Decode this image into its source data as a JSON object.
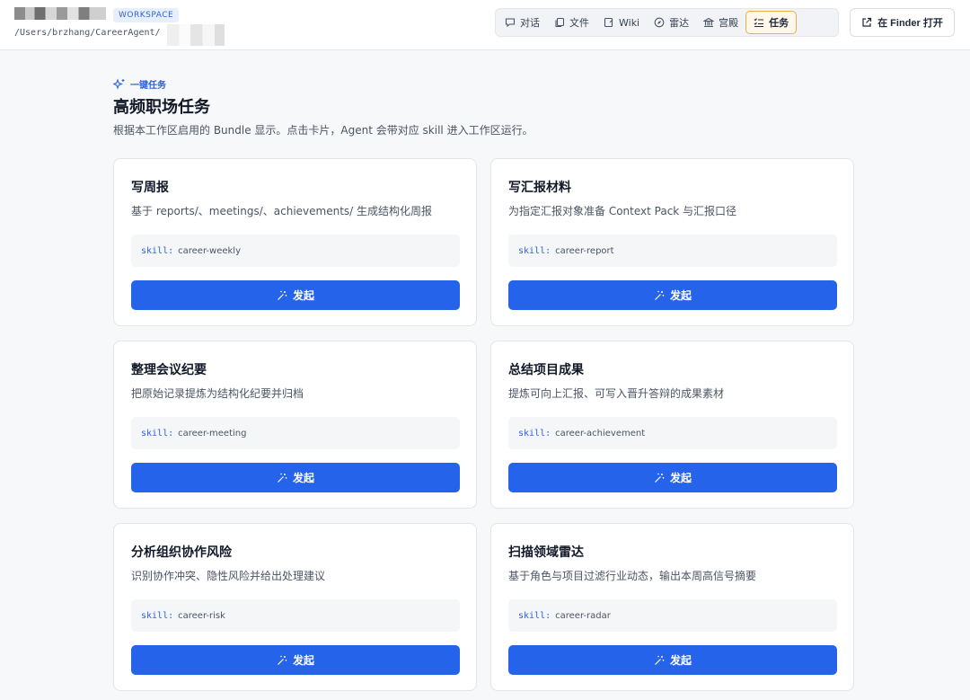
{
  "header": {
    "workspace_badge": "WORKSPACE",
    "workspace_path": "/Users/brzhang/CareerAgent/",
    "nav_tabs": [
      {
        "label": "对话",
        "icon": "chat-icon",
        "active": false
      },
      {
        "label": "文件",
        "icon": "files-icon",
        "active": false
      },
      {
        "label": "Wiki",
        "icon": "wiki-icon",
        "active": false
      },
      {
        "label": "雷达",
        "icon": "compass-icon",
        "active": false
      },
      {
        "label": "宫殿",
        "icon": "palace-icon",
        "active": false
      },
      {
        "label": "任务",
        "icon": "task-list-icon",
        "active": true
      }
    ],
    "open_finder_label": "在 Finder 打开"
  },
  "main": {
    "kicker": "一键任务",
    "title": "高频职场任务",
    "description": "根据本工作区启用的 Bundle 显示。点击卡片，Agent 会带对应 skill 进入工作区运行。",
    "skill_prefix": "skill:",
    "launch_label": "发起",
    "cards": [
      {
        "title": "写周报",
        "description": "基于 reports/、meetings/、achievements/ 生成结构化周报",
        "skill": "career-weekly"
      },
      {
        "title": "写汇报材料",
        "description": "为指定汇报对象准备 Context Pack 与汇报口径",
        "skill": "career-report"
      },
      {
        "title": "整理会议纪要",
        "description": "把原始记录提炼为结构化纪要并归档",
        "skill": "career-meeting"
      },
      {
        "title": "总结项目成果",
        "description": "提炼可向上汇报、可写入晋升答辩的成果素材",
        "skill": "career-achievement"
      },
      {
        "title": "分析组织协作风险",
        "description": "识别协作冲突、隐性风险并给出处理建议",
        "skill": "career-risk"
      },
      {
        "title": "扫描领域雷达",
        "description": "基于角色与项目过滤行业动态，输出本周高信号摘要",
        "skill": "career-radar"
      }
    ]
  },
  "colors": {
    "accent": "#2563eb",
    "active_tab_border": "#eab04a",
    "badge_bg": "#e8effc"
  }
}
